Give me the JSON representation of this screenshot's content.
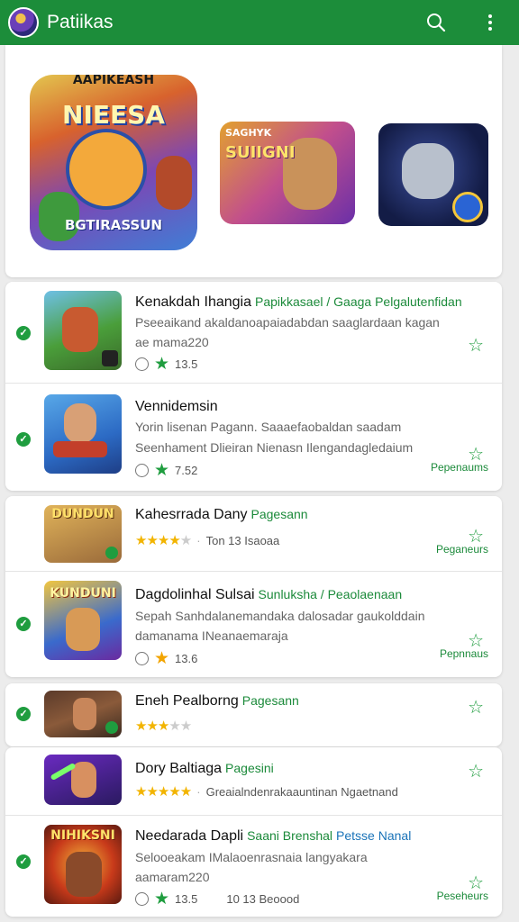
{
  "appbar": {
    "title": "Patiikas",
    "search_icon": "search-icon",
    "menu_icon": "more-vert-icon",
    "color": "#1c8d3a"
  },
  "featured": [
    {
      "line1": "AAPIKEASH",
      "line2": "NIEESA",
      "line3": "BGTIRASSUN"
    },
    {
      "line1": "SAGHYK",
      "line2": "SUIIGNI"
    },
    {
      "line1": ""
    }
  ],
  "apps": [
    {
      "title": "Kenakdah Ihangia",
      "tag": "Papikkasael / Gaaga Pelgalutenfidan",
      "desc1": "Pseeaikand akaldanoapaiadabdan saaglardaan kagan",
      "desc2": "ae mama220",
      "rating": "13.5"
    },
    {
      "title": "Vennidemsin",
      "desc1": "Yorin lisenan Pagann. Saaaefaobaldan saadam",
      "desc2": "Seenhament Dlieiran Nienasn Ilengandagledaium",
      "rating": "7.52",
      "category": "Pepenaums"
    },
    {
      "title": "Kahesrrada Dany",
      "tag": "Pagesann",
      "meta": "Ton 13 Isaoaa",
      "category": "Peganeurs"
    },
    {
      "title": "Dagdolinhal Sulsai",
      "tag": "Sunluksha / Peaolaenaan",
      "desc1": "Sepah Sanhdalanemandaka dalosadar gaukolddain",
      "desc2": "damanama INeanaemaraja",
      "rating": "13.6",
      "category": "Pepnnaus"
    },
    {
      "title": "Eneh Pealborng",
      "tag": "Pagesann"
    },
    {
      "title": "Dory Baltiaga",
      "tag": "Pagesini",
      "meta": "Greaialndenrakaauntinan Ngaetnand"
    },
    {
      "title": "Needarada Dapli",
      "tag": "Saani Brenshal",
      "tag2": "Petsse Nanal",
      "desc1": "Selooeakam IMalaoenrasnaia langyakara",
      "desc2": "aamaram220",
      "rating": "13.5",
      "meta2": "10 13 Beoood",
      "category": "Peseheurs"
    }
  ]
}
